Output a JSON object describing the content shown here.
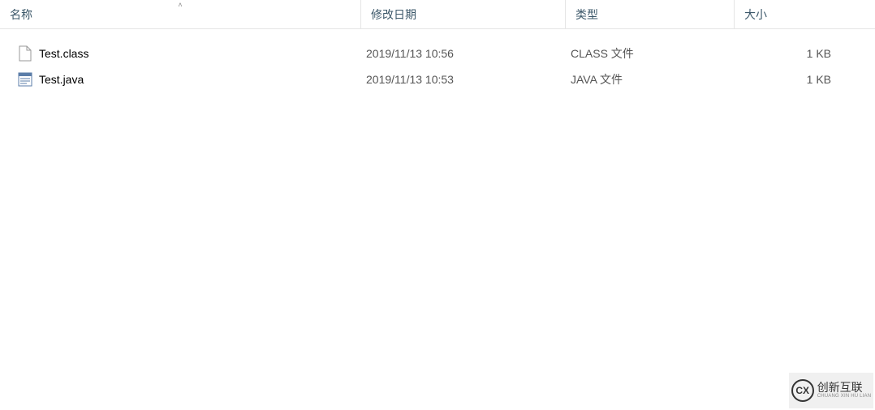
{
  "columns": {
    "name": "名称",
    "date": "修改日期",
    "type": "类型",
    "size": "大小"
  },
  "files": [
    {
      "name": "Test.class",
      "date": "2019/11/13 10:56",
      "type": "CLASS 文件",
      "size": "1 KB",
      "icon": "blank-file"
    },
    {
      "name": "Test.java",
      "date": "2019/11/13 10:53",
      "type": "JAVA 文件",
      "size": "1 KB",
      "icon": "java-file"
    }
  ],
  "watermark": {
    "logo_text": "CX",
    "main": "创新互联",
    "sub": "CHUANG XIN HU LIAN"
  }
}
